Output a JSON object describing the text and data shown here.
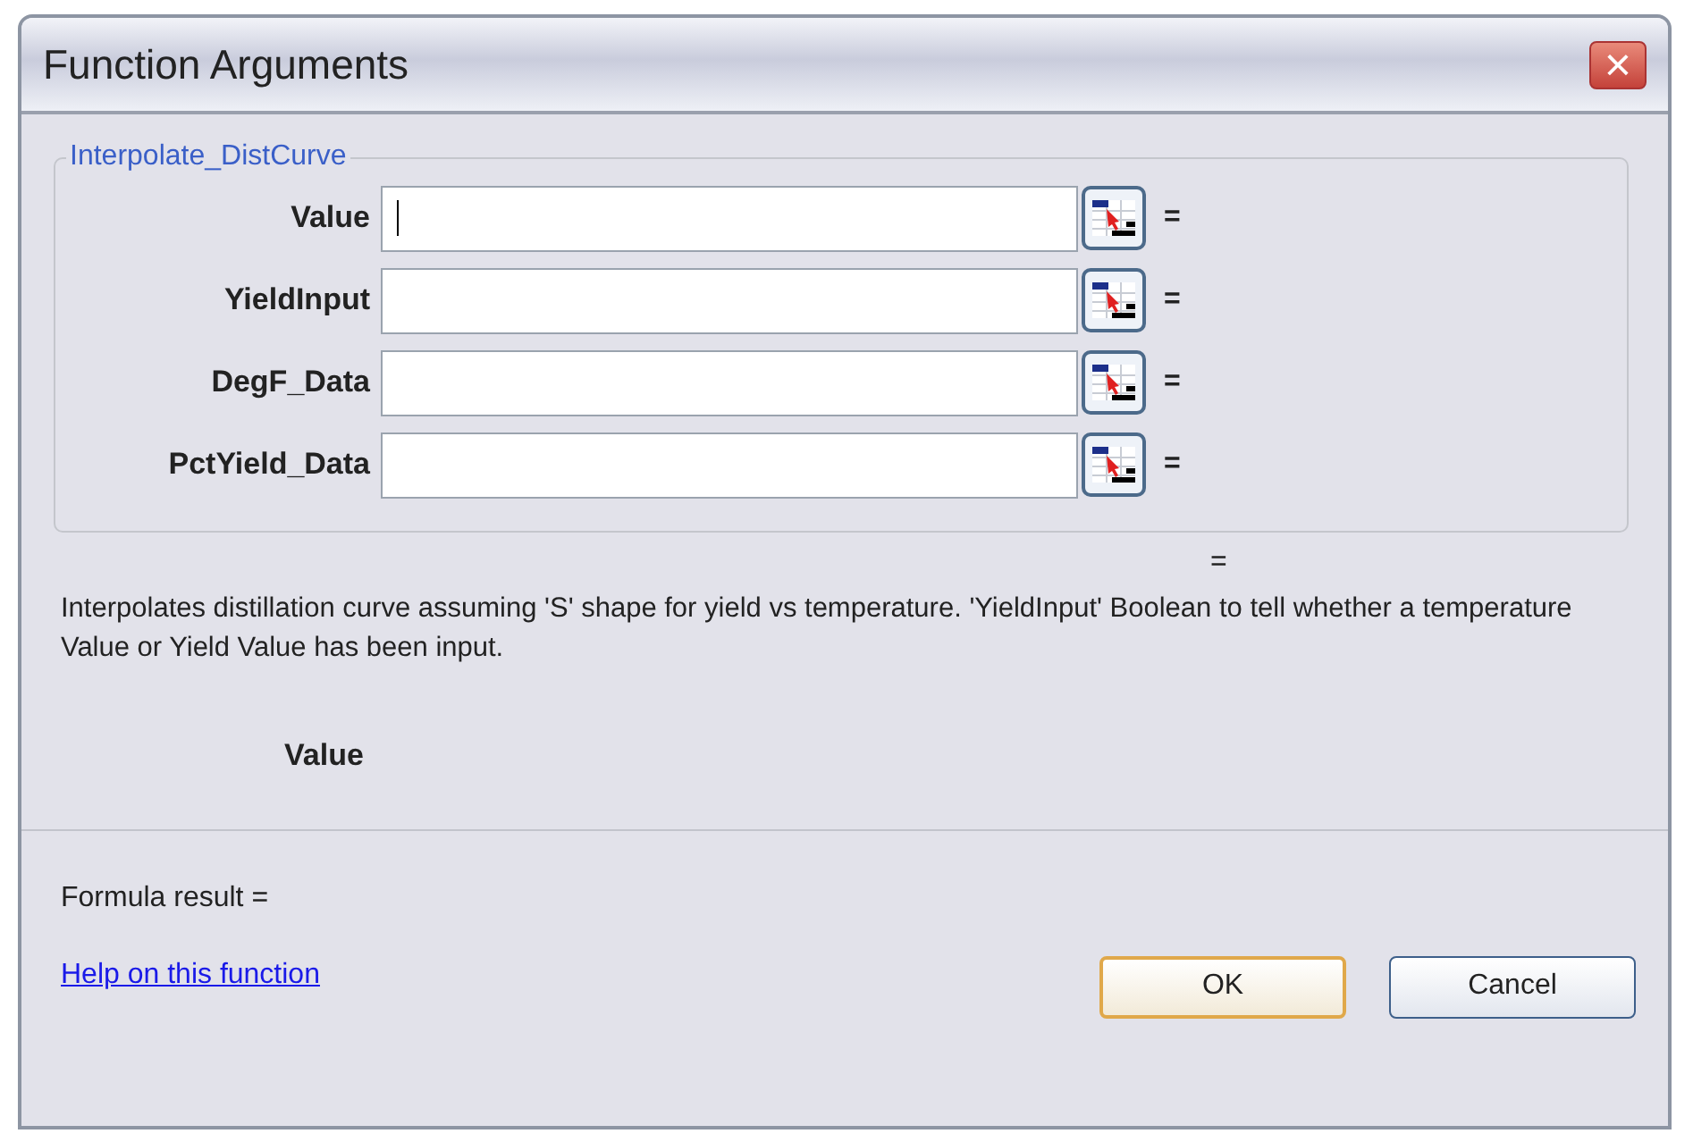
{
  "window": {
    "title": "Function Arguments",
    "close": "×"
  },
  "group": {
    "legend": "Interpolate_DistCurve",
    "arguments": [
      {
        "label": "Value",
        "focused": true,
        "equals": "="
      },
      {
        "label": "YieldInput",
        "focused": false,
        "equals": "="
      },
      {
        "label": "DegF_Data",
        "focused": false,
        "equals": "="
      },
      {
        "label": "PctYield_Data",
        "focused": false,
        "equals": "="
      }
    ]
  },
  "result_equals": "=",
  "description": "Interpolates distillation curve assuming 'S' shape for yield vs temperature. 'YieldInput' Boolean to tell whether a temperature Value or Yield Value has been input.",
  "argument_name": "Value",
  "formula_result": "Formula result =",
  "help_link": "Help on this function",
  "buttons": [
    {
      "label": "OK",
      "default": true
    },
    {
      "label": "Cancel",
      "default": false
    }
  ]
}
